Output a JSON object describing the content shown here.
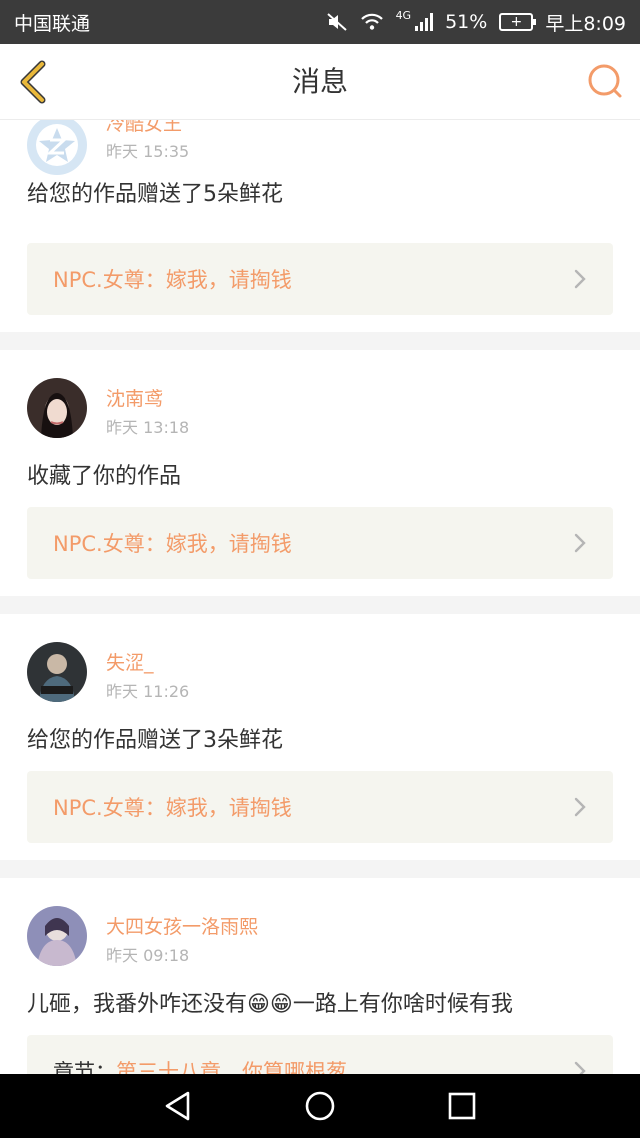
{
  "status_bar": {
    "carrier": "中国联通",
    "network": "4G",
    "battery": "51%",
    "time": "早上8:09"
  },
  "header": {
    "title": "消息",
    "back_icon": "chevron-left-icon",
    "search_icon": "search-icon"
  },
  "messages": [
    {
      "username": "冷酷女王",
      "time": "昨天 15:35",
      "text": "给您的作品赠送了5朵鲜花",
      "quote_prefix": "NPC.女尊：",
      "quote_title": "嫁我，请掏钱"
    },
    {
      "username": "沈南鸢",
      "time": "昨天 13:18",
      "text": "收藏了你的作品",
      "quote_prefix": "NPC.女尊：",
      "quote_title": "嫁我，请掏钱"
    },
    {
      "username": "失涩_",
      "time": "昨天 11:26",
      "text": "给您的作品赠送了3朵鲜花",
      "quote_prefix": "NPC.女尊：",
      "quote_title": "嫁我，请掏钱"
    },
    {
      "username": "大四女孩一洛雨熙",
      "time": "昨天 09:18",
      "text": "儿砸，我番外咋还没有😁😁一路上有你啥时候有我",
      "quote_prefix": "章节：",
      "quote_title": "第三十八章　你算哪根葱"
    }
  ],
  "colors": {
    "accent": "#f39b69",
    "back_icon": "#e9b83a",
    "status_bar": "#3b3b3b",
    "quote_bg": "#f5f5ef"
  }
}
